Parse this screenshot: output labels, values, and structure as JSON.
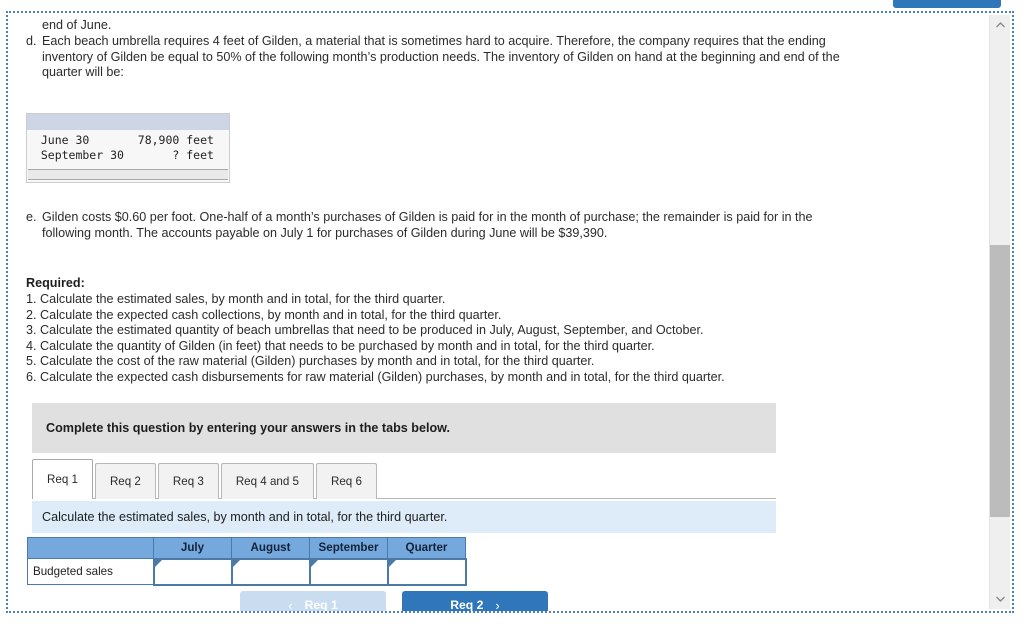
{
  "top_button": {
    "label": ""
  },
  "question": {
    "fragment_top": "end of June.",
    "item_d": {
      "marker": "d.",
      "text": "Each beach umbrella requires 4 feet of Gilden, a material that is sometimes hard to acquire. Therefore, the company requires that the ending inventory of Gilden be equal to 50% of the following month’s production needs. The inventory of Gilden on hand at the beginning and end of the quarter will be:"
    },
    "inventory_box": {
      "rows": [
        {
          "label": "June 30",
          "value": "78,900",
          "unit": "feet"
        },
        {
          "label": "September 30",
          "value": "?",
          "unit": "feet"
        }
      ],
      "raw": "  June 30       78,900 feet\n  September 30       ? feet"
    },
    "item_e": {
      "marker": "e.",
      "text": "Gilden costs $0.60 per foot. One-half of a month’s purchases of Gilden is paid for in the month of purchase; the remainder is paid for in the following month. The accounts payable on July 1 for purchases of Gilden during June will be $39,390."
    },
    "required_heading": "Required:",
    "required_items": [
      "1. Calculate the estimated sales, by month and in total, for the third quarter.",
      "2. Calculate the expected cash collections, by month and in total, for the third quarter.",
      "3. Calculate the estimated quantity of beach umbrellas that need to be produced in July, August, September, and October.",
      "4. Calculate the quantity of Gilden (in feet) that needs to be purchased by month and in total, for the third quarter.",
      "5. Calculate the cost of the raw material (Gilden) purchases by month and in total, for the third quarter.",
      "6. Calculate the expected cash disbursements for raw material (Gilden) purchases, by month and in total, for the third quarter."
    ]
  },
  "complete_banner": {
    "text": "Complete this question by entering your answers in the tabs below."
  },
  "tabs": [
    {
      "label": "Req 1",
      "active": true
    },
    {
      "label": "Req 2",
      "active": false
    },
    {
      "label": "Req 3",
      "active": false
    },
    {
      "label": "Req 4 and 5",
      "active": false
    },
    {
      "label": "Req 6",
      "active": false
    }
  ],
  "instruction": {
    "text": "Calculate the estimated sales, by month and in total, for the third quarter."
  },
  "answer_table": {
    "corner_label": "",
    "columns": [
      "July",
      "August",
      "September",
      "Quarter"
    ],
    "rows": [
      {
        "label": "Budgeted sales",
        "values": [
          "",
          "",
          "",
          ""
        ]
      }
    ]
  },
  "navigation": {
    "prev_label": "Req 1",
    "prev_chevron": "‹",
    "next_label": "Req 2",
    "next_chevron": "›"
  },
  "colors": {
    "accent_blue": "#2f76bb",
    "table_header_blue": "#75a8dc",
    "instruction_blue": "#ddecf8",
    "banner_gray": "#e0e0e0",
    "panel_border": "#4a7fc1"
  }
}
